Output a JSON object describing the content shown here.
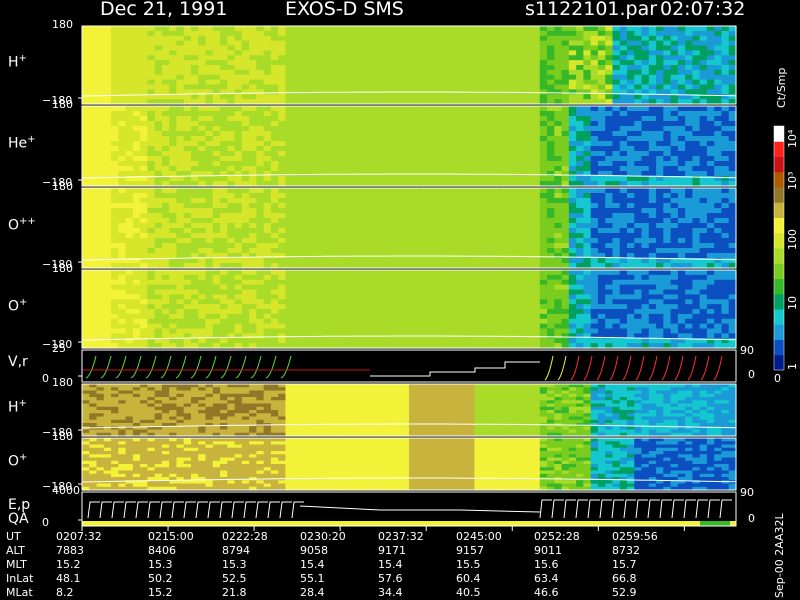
{
  "header": {
    "date": "Dec 21, 1991",
    "instrument": "EXOS-D SMS",
    "file": "s1122101.par",
    "time": "02:07:32"
  },
  "chart_data": {
    "type": "heatmap",
    "panels": [
      {
        "id": "H+",
        "label": "H",
        "sup": "+",
        "ylim": [
          -180,
          180
        ],
        "tick_top": "180",
        "tick_bottom": "−180"
      },
      {
        "id": "He+",
        "label": "He",
        "sup": "+",
        "ylim": [
          -180,
          180
        ],
        "tick_top": "180",
        "tick_bottom": "−180"
      },
      {
        "id": "O++",
        "label": "O",
        "sup": "++",
        "ylim": [
          -180,
          180
        ],
        "tick_top": "180",
        "tick_bottom": "−180"
      },
      {
        "id": "O+",
        "label": "O",
        "sup": "+",
        "ylim": [
          -180,
          180
        ],
        "tick_top": "180",
        "tick_bottom": "−180"
      },
      {
        "id": "Vr",
        "label": "V,r",
        "sup": "",
        "ylim": [
          0,
          25
        ],
        "tick_top": "25",
        "tick_bottom": "0",
        "right_top": "90",
        "right_bottom": "0"
      },
      {
        "id": "H+b",
        "label": "H",
        "sup": "+",
        "ylim": [
          -180,
          180
        ],
        "tick_top": "180",
        "tick_bottom": "−180"
      },
      {
        "id": "O+b",
        "label": "O",
        "sup": "+",
        "ylim": [
          -180,
          180
        ],
        "tick_top": "180",
        "tick_bottom": "−180"
      },
      {
        "id": "Ep",
        "label": "E,p",
        "sup": "",
        "label2": "QA",
        "ylim": [
          0,
          4000
        ],
        "tick_top": "4000",
        "tick_bottom": "0",
        "right_top": "90",
        "right_bottom": "0"
      }
    ],
    "colorbar": {
      "label": "Ct/Smp",
      "scale": "log",
      "range": [
        1,
        10000
      ],
      "ticks": [
        "10⁴",
        "10³",
        "100",
        "10",
        "1"
      ],
      "bottom_value": "0"
    },
    "time_axis": [
      "0207:32",
      "0215:00",
      "0222:28",
      "0230:20",
      "0237:32",
      "0245:00",
      "0252:28",
      "0259:56"
    ],
    "ephemeris": [
      {
        "name": "UT",
        "values": [
          "0207:32",
          "0215:00",
          "0222:28",
          "0230:20",
          "0237:32",
          "0245:00",
          "0252:28",
          "0259:56"
        ]
      },
      {
        "name": "ALT",
        "values": [
          "7883",
          "8406",
          "8794",
          "9058",
          "9171",
          "9157",
          "9011",
          "8732"
        ]
      },
      {
        "name": "MLT",
        "values": [
          "15.2",
          "15.3",
          "15.3",
          "15.4",
          "15.4",
          "15.5",
          "15.6",
          "15.7"
        ]
      },
      {
        "name": "InLat",
        "values": [
          "48.1",
          "50.2",
          "52.5",
          "55.1",
          "57.6",
          "60.4",
          "63.4",
          "66.8"
        ]
      },
      {
        "name": "MLat",
        "values": [
          "8.2",
          "15.2",
          "21.8",
          "28.4",
          "34.4",
          "40.5",
          "46.6",
          "52.9"
        ]
      }
    ]
  },
  "footer": {
    "stamp": "Sep-00  2AA32L"
  },
  "colors": {
    "background": "#000000",
    "palette": [
      "#001a8c",
      "#0b4fc0",
      "#1a9ad6",
      "#15c8d0",
      "#00a060",
      "#37b828",
      "#7acc1e",
      "#a9dc28",
      "#d6e62a",
      "#f2f238",
      "#c8b43c",
      "#907826",
      "#b05a00",
      "#c81414",
      "#ff2020",
      "#ffffff"
    ]
  }
}
